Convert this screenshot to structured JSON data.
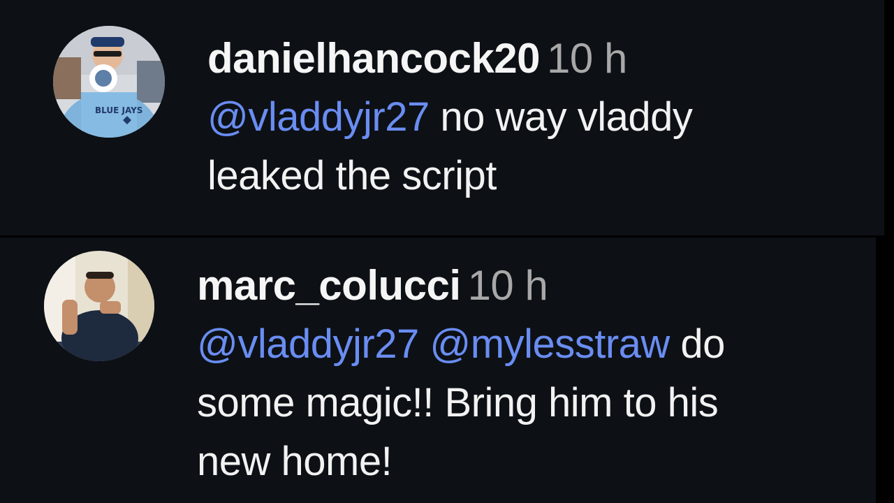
{
  "colors": {
    "background": "#0d1116",
    "text": "#f2f2f2",
    "timestamp": "#a8a8a8",
    "mention": "#6a8df2"
  },
  "comments": [
    {
      "username": "danielhancock20",
      "time": "10 h",
      "avatar_icon": "profile-photo-baseball-fan",
      "mentions": [
        "@vladdyjr27"
      ],
      "text_line1": " no way vladdy",
      "text_line2": "leaked the script"
    },
    {
      "username": "marc_colucci",
      "time": "10 h",
      "avatar_icon": "profile-photo-selfie",
      "mentions": [
        "@vladdyjr27",
        "@mylesstraw"
      ],
      "text_line1": " do",
      "text_line2": "some magic!! Bring him to his",
      "text_line3": "new home!"
    }
  ]
}
